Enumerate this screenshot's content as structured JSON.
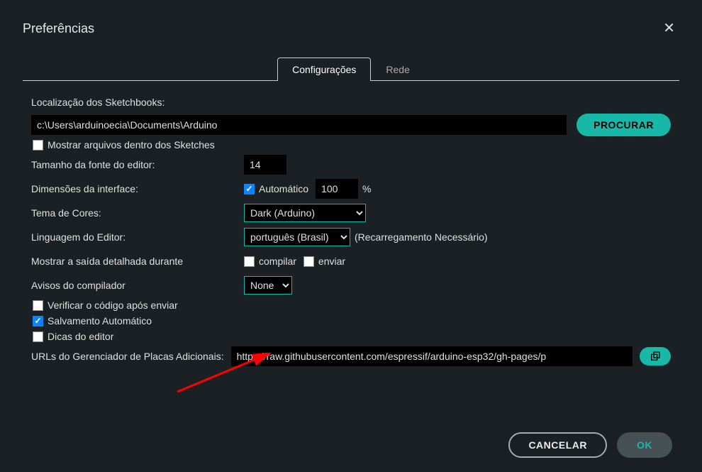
{
  "dialog": {
    "title": "Preferências",
    "close_glyph": "✕"
  },
  "tabs": {
    "settings": "Configurações",
    "network": "Rede"
  },
  "sketchbook": {
    "label": "Localização dos Sketchbooks:",
    "path": "c:\\Users\\arduinoecia\\Documents\\Arduino",
    "browse": "PROCURAR",
    "show_files": "Mostrar arquivos dentro dos Sketches"
  },
  "editor": {
    "font_size_label": "Tamanho da fonte do editor:",
    "font_size_value": "14",
    "scale_label": "Dimensões da interface:",
    "scale_auto": "Automático",
    "scale_value": "100",
    "scale_suffix": "%",
    "theme_label": "Tema de Cores:",
    "theme_value": "Dark (Arduino)",
    "lang_label": "Linguagem do Editor:",
    "lang_value": "português (Brasil)",
    "lang_hint": "(Recarregamento Necessário)",
    "verbose_label": "Mostrar a saída detalhada durante",
    "verbose_compile": "compilar",
    "verbose_upload": "enviar",
    "warnings_label": "Avisos do compilador",
    "warnings_value": "None",
    "verify_after": "Verificar o código após enviar",
    "autosave": "Salvamento Automático",
    "hints": "Dicas do editor",
    "urls_label": "URLs do Gerenciador de Placas Adicionais:",
    "urls_value": "https://raw.githubusercontent.com/espressif/arduino-esp32/gh-pages/p"
  },
  "footer": {
    "cancel": "CANCELAR",
    "ok": "OK"
  }
}
